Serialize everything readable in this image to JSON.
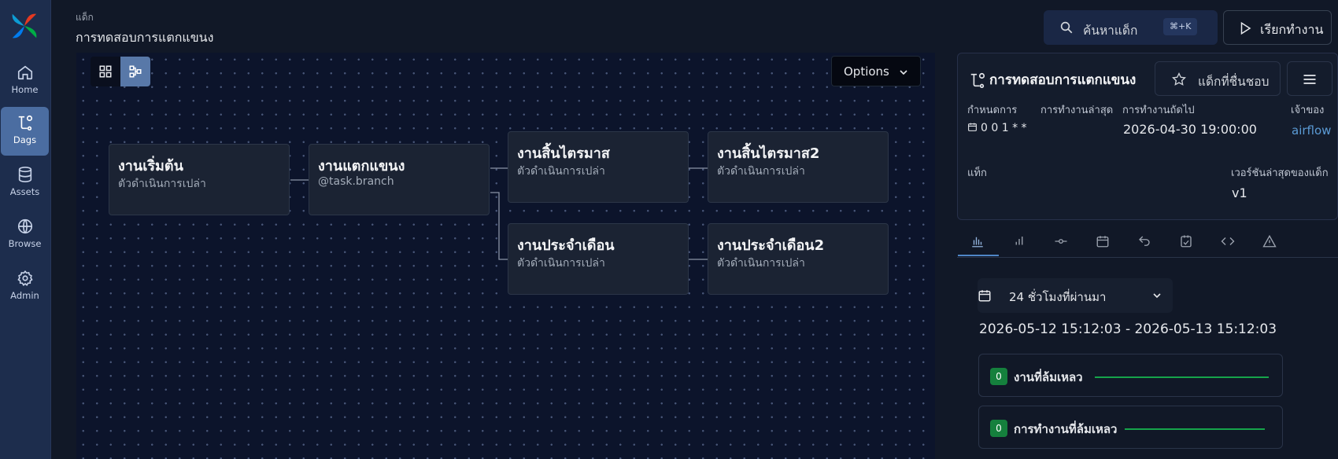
{
  "colors": {
    "nav_bg": "#1d2d4d",
    "canvas_bg": "#0c142b",
    "accent": "#4f86c6",
    "success": "#16a34a",
    "link": "#5b9bd5"
  },
  "nav": {
    "items": [
      {
        "label": "Home",
        "icon": "home-icon"
      },
      {
        "label": "Dags",
        "icon": "dags-icon",
        "active": true
      },
      {
        "label": "Assets",
        "icon": "database-icon"
      },
      {
        "label": "Browse",
        "icon": "globe-icon"
      },
      {
        "label": "Admin",
        "icon": "gear-icon"
      }
    ]
  },
  "header": {
    "breadcrumb_label": "แด็ก",
    "dag_title": "การทดสอบการแตกแขนง",
    "search_label": "ค้นหาแด็ก",
    "search_shortcut": "⌘+K",
    "run_label": "เรียกทำงาน"
  },
  "graph": {
    "options_label": "Options",
    "nodes": [
      {
        "title": "งานเริ่มต้น",
        "subtitle": "ตัวดำเนินการเปล่า"
      },
      {
        "title": "งานแตกแขนง",
        "subtitle": "@task.branch"
      },
      {
        "title": "งานสิ้นไตรมาส",
        "subtitle": "ตัวดำเนินการเปล่า"
      },
      {
        "title": "งานสิ้นไตรมาส2",
        "subtitle": "ตัวดำเนินการเปล่า"
      },
      {
        "title": "งานประจำเดือน",
        "subtitle": "ตัวดำเนินการเปล่า"
      },
      {
        "title": "งานประจำเดือน2",
        "subtitle": "ตัวดำเนินการเปล่า"
      }
    ]
  },
  "details": {
    "title": "การทดสอบการแตกแขนง",
    "favorite_label": "แด็กที่ชื่นชอบ",
    "schedule_label": "กำหนดการ",
    "schedule_value": "0 0 1 * *",
    "last_run_label": "การทำงานล่าสุด",
    "next_run_label": "การทำงานถัดไป",
    "next_run_value": "2026-04-30 19:00:00",
    "owner_label": "เจ้าของ",
    "owner_value": "airflow",
    "tags_label": "แท็ก",
    "version_label": "เวอร์ชันล่าสุดของแด็ก",
    "version_value": "v1"
  },
  "tabs": [
    "overview-icon",
    "bar-chart-icon",
    "task-icon",
    "calendar-icon",
    "backfill-icon",
    "audit-log-icon",
    "code-icon",
    "warning-icon"
  ],
  "overview": {
    "range_select_value": "24 ชั่วโมงที่ผ่านมา",
    "range_text": "2026-05-12 15:12:03 - 2026-05-13 15:12:03",
    "stats": [
      {
        "count": "0",
        "label": "งานที่ล้มเหลว"
      },
      {
        "count": "0",
        "label": "การทำงานที่ล้มเหลว"
      }
    ]
  }
}
